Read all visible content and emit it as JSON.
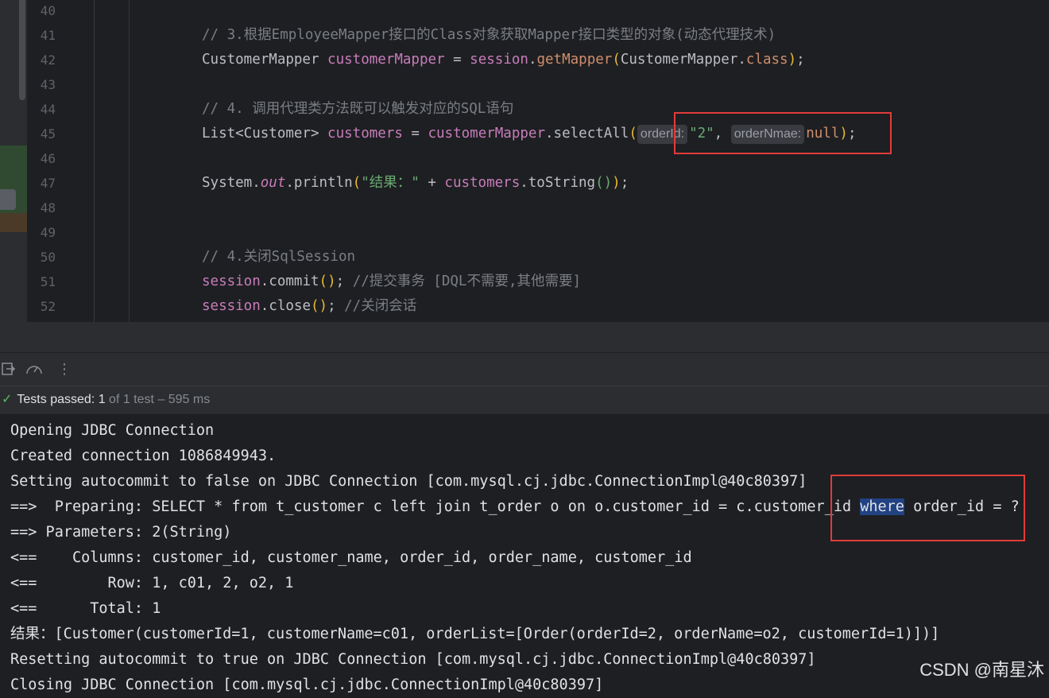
{
  "editor": {
    "line_numbers": [
      "40",
      "41",
      "42",
      "43",
      "44",
      "45",
      "46",
      "47",
      "48",
      "49",
      "50",
      "51",
      "52"
    ],
    "line41": {
      "comment": "// 3.根据EmployeeMapper接口的Class对象获取Mapper接口类型的对象(动态代理技术)"
    },
    "line42": {
      "type": "CustomerMapper ",
      "var": "customerMapper",
      "eq": " = ",
      "obj": "session",
      "dot": ".",
      "method": "getMapper",
      "open": "(",
      "arg": "CustomerMapper.",
      "kw": "class",
      "close": ")",
      "semi": ";"
    },
    "line44": {
      "comment": "// 4. 调用代理类方法既可以触发对应的SQL语句"
    },
    "line45": {
      "type": "List<Customer> ",
      "var": "customers",
      "eq": " = ",
      "obj": "customerMapper",
      "dot": ".",
      "method": "selectAll",
      "open": "(",
      "hint1": "orderId:",
      "arg1": "\"2\"",
      "comma": ", ",
      "hint2": "orderNmae:",
      "arg2": "null",
      "close": ")",
      "semi": ";"
    },
    "line47": {
      "cls": "System.",
      "field": "out",
      "call": ".println",
      "open": "(",
      "str": "\"结果：\"",
      "plus": " + ",
      "var": "customers",
      "call2": ".toString",
      "parens": "()",
      "close": ")",
      "semi": ";"
    },
    "line50": {
      "comment": "// 4.关闭SqlSession"
    },
    "line51": {
      "obj": "session",
      "call": ".commit",
      "parens": "()",
      "semi": "; ",
      "comment": "//提交事务 [DQL不需要,其他需要]"
    },
    "line52": {
      "obj": "session",
      "call": ".close",
      "parens": "()",
      "semi": "; ",
      "comment": "//关闭会话"
    }
  },
  "toolbar": {
    "icons": [
      "import-icon",
      "gauge-icon",
      "more-icon"
    ]
  },
  "status": {
    "label": "Tests passed: ",
    "count": "1",
    "rest": " of 1 test – 595 ms"
  },
  "console": {
    "lines": [
      "Opening JDBC Connection",
      "Created connection 1086849943.",
      "Setting autocommit to false on JDBC Connection [com.mysql.cj.jdbc.ConnectionImpl@40c80397]"
    ],
    "preparing_before": "==>  Preparing: SELECT * from t_customer c left join t_order o on o.customer_id = c.customer_id ",
    "preparing_selected": "where",
    "preparing_after": " order_id = ?",
    "lines2": [
      "==> Parameters: 2(String)",
      "<==    Columns: customer_id, customer_name, order_id, order_name, customer_id",
      "<==        Row: 1, c01, 2, o2, 1",
      "<==      Total: 1",
      "结果：[Customer(customerId=1, customerName=c01, orderList=[Order(orderId=2, orderName=o2, customerId=1)])]",
      "Resetting autocommit to true on JDBC Connection [com.mysql.cj.jdbc.ConnectionImpl@40c80397]",
      "Closing JDBC Connection [com.mysql.cj.jdbc.ConnectionImpl@40c80397]"
    ]
  },
  "watermark": "CSDN @南星沐"
}
